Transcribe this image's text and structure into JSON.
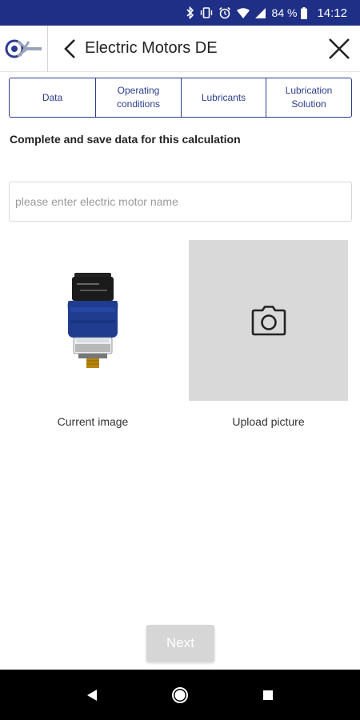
{
  "status_bar": {
    "battery_percent": "84 %",
    "time": "14:12",
    "icons": [
      "bluetooth-icon",
      "vibrate-icon",
      "alarm-icon",
      "wifi-icon",
      "signal-icon",
      "battery-icon"
    ]
  },
  "header": {
    "title": "Electric Motors DE",
    "logo": "logo"
  },
  "tabs": [
    {
      "label": "Data"
    },
    {
      "label": "Operating conditions"
    },
    {
      "label": "Lubricants"
    },
    {
      "label": "Lubrication Solution"
    }
  ],
  "main": {
    "instruction": "Complete and save data for this calculation",
    "motor_name_input": {
      "value": "",
      "placeholder": "please enter electric motor name"
    },
    "current_image_label": "Current image",
    "upload_label": "Upload picture",
    "next_label": "Next"
  },
  "colors": {
    "status_bar": "#1f2f86",
    "accent": "#2c3d8f",
    "upload_box": "#d9d9d9",
    "next_button_disabled": "#d6d6d6",
    "nav_bar": "#000000"
  }
}
